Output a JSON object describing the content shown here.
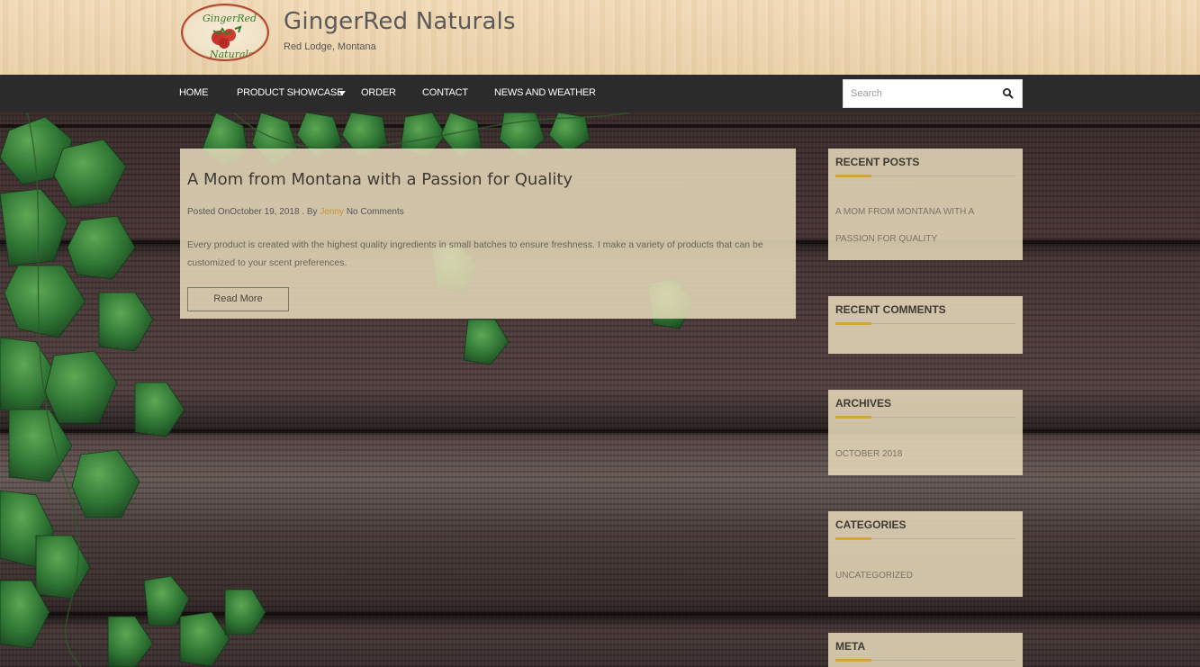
{
  "site": {
    "title": "GingerRed Naturals",
    "tagline": "Red Lodge, Montana",
    "logo_text_top": "GingerRed",
    "logo_text_bottom": "Naturals"
  },
  "nav": {
    "items": [
      {
        "label": "HOME"
      },
      {
        "label": "PRODUCT SHOWCASE",
        "has_dropdown": true
      },
      {
        "label": "ORDER"
      },
      {
        "label": "CONTACT"
      },
      {
        "label": "NEWS AND WEATHER"
      }
    ],
    "search_placeholder": "Search",
    "search_icon": "search-icon"
  },
  "post": {
    "title": "A Mom from Montana with a Passion for Quality",
    "posted_on_label": "Posted On",
    "date": "October 19, 2018",
    "by_label": "By",
    "author": "Jenny",
    "comments": "No Comments",
    "excerpt": "Every product is created with the highest quality ingredients in small batches to ensure freshness. I make a variety of products that can be customized to your scent preferences.",
    "read_more": "Read More"
  },
  "sidebar": {
    "recent_posts": {
      "title": "RECENT POSTS",
      "items": [
        "A MOM FROM MONTANA WITH A",
        "PASSION FOR QUALITY"
      ]
    },
    "recent_comments": {
      "title": "RECENT COMMENTS"
    },
    "archives": {
      "title": "ARCHIVES",
      "items": [
        "OCTOBER 2018"
      ]
    },
    "categories": {
      "title": "CATEGORIES",
      "items": [
        "UNCATEGORIZED"
      ]
    },
    "meta": {
      "title": "META"
    }
  },
  "colors": {
    "nav_bg": "#2b2b2b",
    "accent": "#d4a43a",
    "card_bg": "#e8dbbc",
    "author_link": "#c49a2f"
  }
}
